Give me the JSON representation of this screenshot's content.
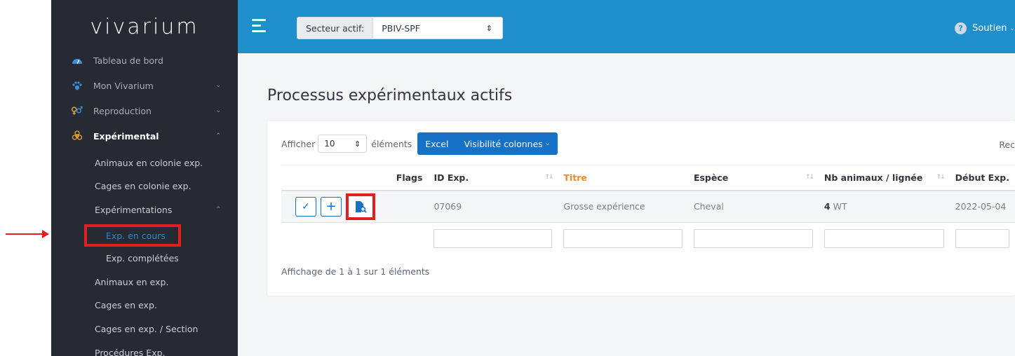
{
  "app": {
    "logo": "vivarium"
  },
  "topbar": {
    "sector_label": "Secteur actif:",
    "sector_value": "PBIV-SPF",
    "help_label": "Soutien"
  },
  "sidebar": {
    "items": [
      {
        "label": "Tableau de bord",
        "icon": "dashboard-icon"
      },
      {
        "label": "Mon Vivarium",
        "icon": "paw-icon"
      },
      {
        "label": "Reproduction",
        "icon": "gender-icon"
      },
      {
        "label": "Expérimental",
        "icon": "biohazard-icon"
      }
    ],
    "sub": [
      "Animaux en colonie exp.",
      "Cages en colonie exp.",
      "Expérimentations",
      "Exp. en cours",
      "Exp. complétées",
      "Animaux en exp.",
      "Cages en exp.",
      "Cages en exp. / Section",
      "Procédures Exp."
    ]
  },
  "main": {
    "title": "Processus expérimentaux actifs",
    "show_label": "Afficher",
    "show_value": "10",
    "elements_label": "éléments",
    "excel_label": "Excel",
    "columns_label": "Visibilité colonnes",
    "search_label": "Rec",
    "table": {
      "headers": [
        "Flags",
        "ID Exp.",
        "Titre",
        "Espèce",
        "Nb animaux / lignée",
        "Début Exp."
      ],
      "row": {
        "id": "07069",
        "titre": "Grosse expérience",
        "espece": "Cheval",
        "nb": "4",
        "lignee": "WT",
        "debut": "2022-05-04"
      }
    },
    "info": "Affichage de 1 à 1 sur 1 éléments"
  },
  "colors": {
    "topbar": "#1f8fcb",
    "sidebar": "#252a33",
    "accent": "#1572c7",
    "highlight": "#e31e1e"
  }
}
